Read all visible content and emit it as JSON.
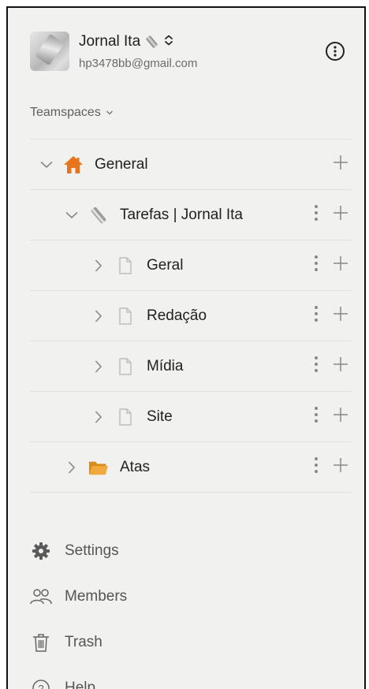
{
  "account": {
    "name": "Jornal Ita",
    "email": "hp3478bb@gmail.com"
  },
  "teamspaces_label": "Teamspaces",
  "tree": {
    "general": {
      "label": "General"
    },
    "tarefas": {
      "label": "Tarefas | Jornal Ita"
    },
    "pages": [
      {
        "label": "Geral"
      },
      {
        "label": "Redação"
      },
      {
        "label": "Mídia"
      },
      {
        "label": "Site"
      }
    ],
    "atas": {
      "label": "Atas"
    }
  },
  "menu": {
    "settings": "Settings",
    "members": "Members",
    "trash": "Trash",
    "help": "Help"
  },
  "colors": {
    "background": "#f1f1ef",
    "home_icon": "#e8731a",
    "folder_icon": "#f2a93b"
  }
}
